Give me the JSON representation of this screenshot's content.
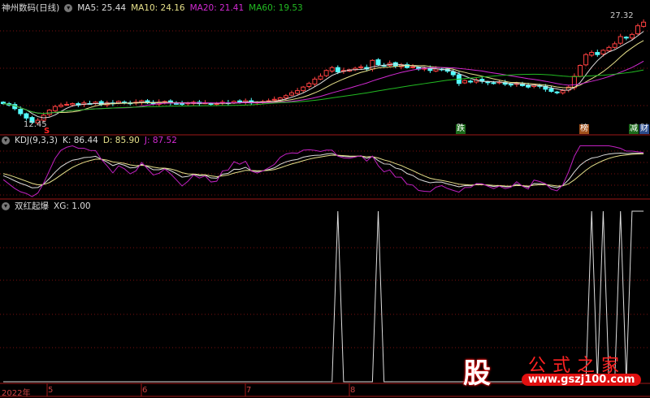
{
  "main": {
    "title": "神州数码(日线)",
    "ma": [
      {
        "label": "MA5: 25.44",
        "color": "#dddddd"
      },
      {
        "label": "MA10: 24.16",
        "color": "#e6e08a"
      },
      {
        "label": "MA20: 21.41",
        "color": "#d22ad2"
      },
      {
        "label": "MA60: 19.53",
        "color": "#22bb22"
      }
    ],
    "low_label": "12.45",
    "high_label": "27.32",
    "markers": {
      "s": "S",
      "die": "跌",
      "bang": "榜",
      "jian": "减",
      "cai": "财"
    }
  },
  "kdj": {
    "title": "KDJ(9,3,3)",
    "k": "K: 86.44",
    "d": "D: 85.90",
    "j": "J: 87.52"
  },
  "xg": {
    "title": "双红起爆",
    "value": "XG: 1.00"
  },
  "axis": {
    "labels": [
      "2022年",
      "5",
      "6",
      "7",
      "8"
    ]
  },
  "watermark": {
    "char": "股",
    "name": "公式之家",
    "url": "www.gszj100.com"
  },
  "colors": {
    "up": "#ff4040",
    "down": "#54fcfc",
    "grid": "#7a1010"
  },
  "chart_data": {
    "type": "candlestick",
    "price_range": [
      12.45,
      27.32
    ],
    "closes": [
      15.2,
      15.0,
      14.5,
      13.8,
      13.2,
      12.6,
      12.9,
      13.6,
      14.3,
      14.8,
      15.0,
      15.1,
      15.2,
      15.0,
      15.3,
      15.2,
      15.4,
      15.1,
      15.3,
      15.2,
      15.5,
      15.3,
      15.2,
      15.4,
      15.6,
      15.3,
      15.2,
      15.4,
      15.5,
      15.3,
      15.2,
      15.1,
      15.3,
      15.4,
      15.2,
      15.3,
      15.1,
      15.2,
      15.4,
      15.3,
      15.5,
      15.4,
      15.6,
      15.3,
      15.4,
      15.5,
      15.6,
      15.8,
      16.0,
      16.3,
      16.7,
      17.0,
      17.5,
      18.0,
      18.6,
      19.0,
      19.8,
      20.2,
      19.6,
      19.8,
      19.9,
      20.1,
      20.3,
      20.0,
      21.2,
      20.6,
      20.5,
      20.8,
      20.4,
      20.6,
      20.2,
      20.3,
      20.0,
      20.1,
      19.8,
      20.0,
      19.9,
      19.7,
      19.2,
      18.0,
      18.4,
      18.2,
      18.5,
      18.3,
      18.1,
      18.0,
      18.2,
      17.9,
      17.8,
      18.0,
      17.7,
      17.5,
      17.8,
      17.6,
      17.2,
      16.9,
      16.7,
      17.0,
      17.5,
      19.0,
      20.5,
      22.0,
      22.3,
      22.0,
      22.6,
      23.0,
      23.5,
      24.5,
      24.3,
      24.8,
      26.0,
      26.5
    ],
    "xg_signal_indices": [
      58,
      65,
      102,
      104,
      107,
      109,
      110,
      111
    ]
  }
}
